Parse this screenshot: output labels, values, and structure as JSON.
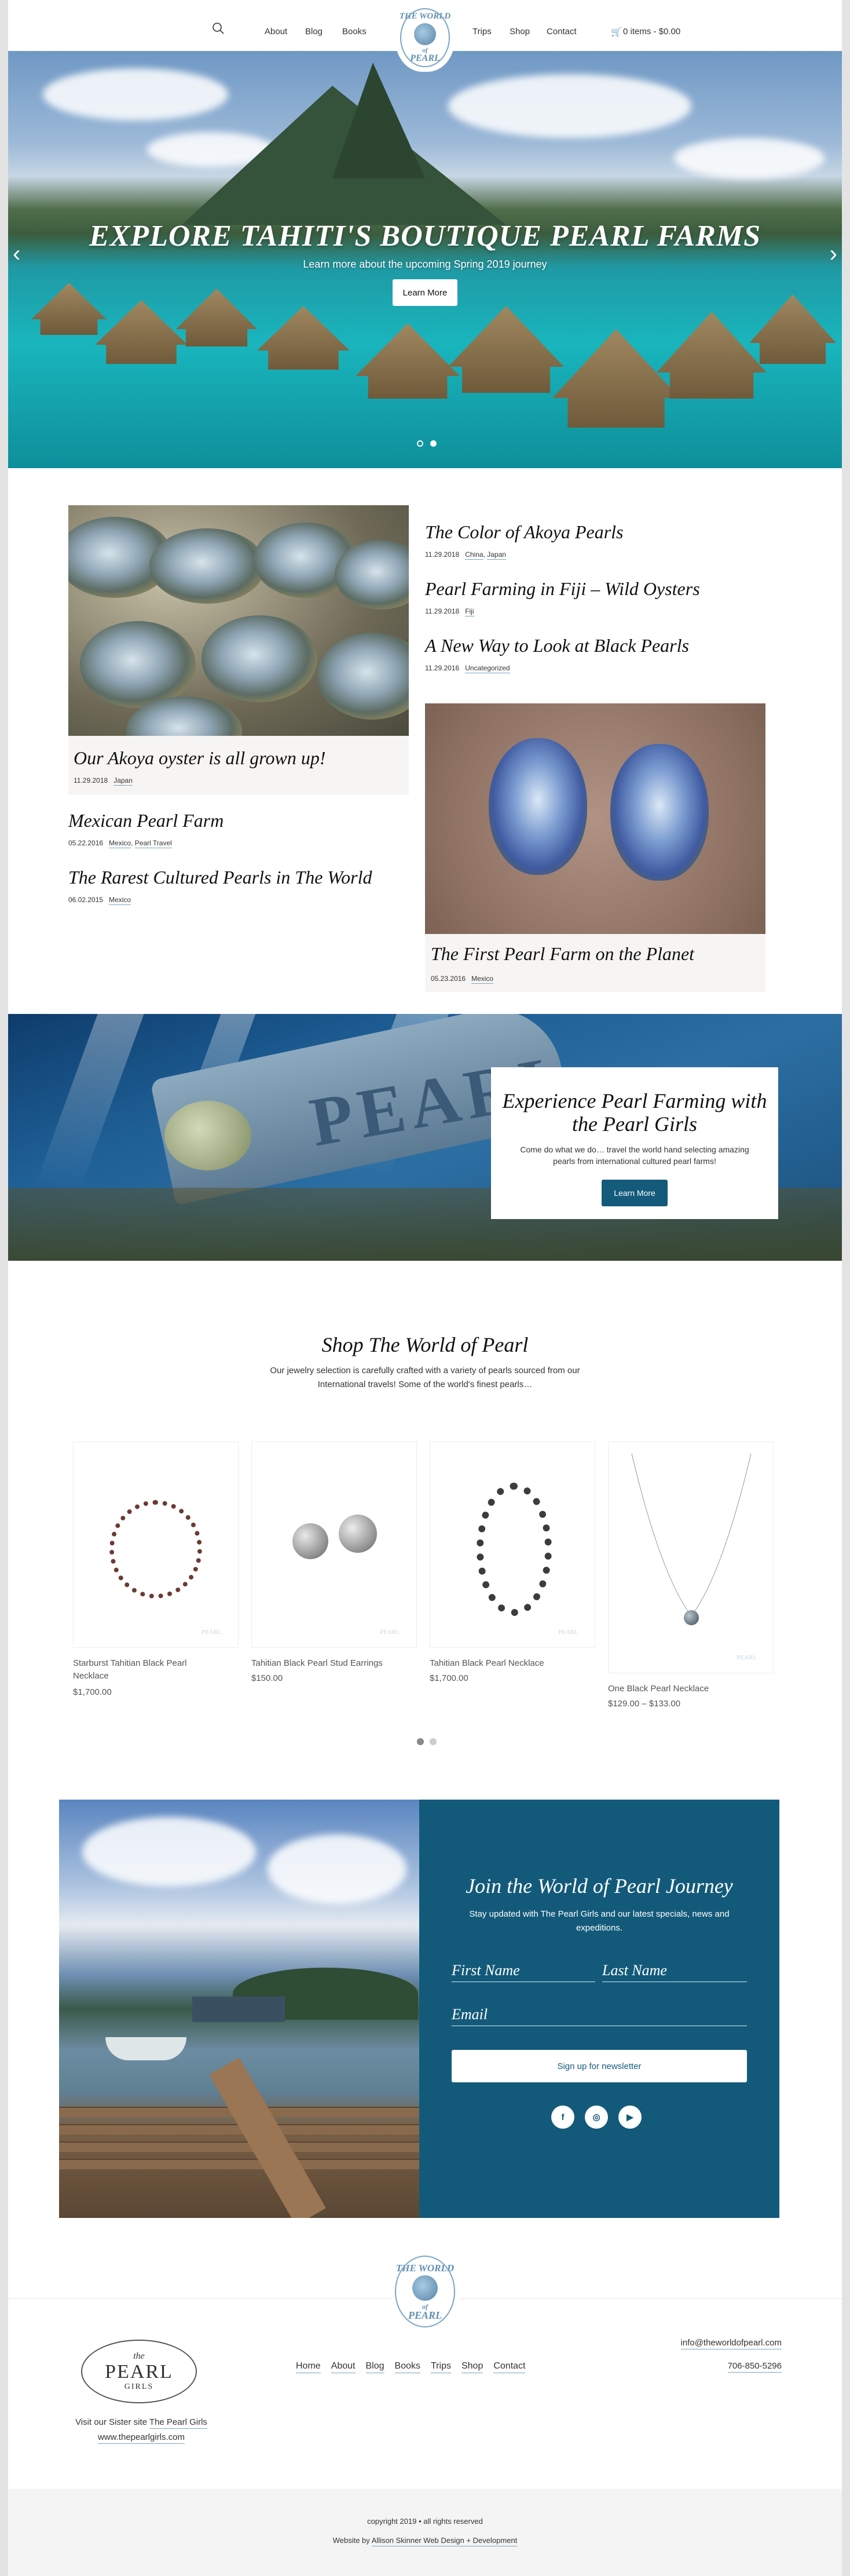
{
  "header": {
    "nav_left": [
      "About",
      "Blog",
      "Books"
    ],
    "nav_right": [
      "Trips",
      "Shop",
      "Contact"
    ],
    "cart_label": "0 items - $0.00",
    "logo_top": "THE WORLD",
    "logo_of": "of",
    "logo_bottom": "PEARL"
  },
  "hero": {
    "title": "EXPLORE TAHITI'S BOUTIQUE PEARL FARMS",
    "subtitle": "Learn more about the upcoming Spring 2019 journey",
    "button": "Learn More"
  },
  "posts": {
    "akoya": {
      "title": "Our Akoya oyster is all grown up!",
      "date": "11.29.2018",
      "tags": "Japan"
    },
    "mexican": {
      "title": "Mexican Pearl Farm",
      "date": "05.22.2016",
      "tag1": "Mexico",
      "tag2": "Pearl Travel"
    },
    "rarest": {
      "title": "The Rarest Cultured Pearls in The World",
      "date": "06.02.2015",
      "tags": "Mexico"
    },
    "color": {
      "title": "The Color of Akoya Pearls",
      "date": "11.29.2018",
      "tag1": "China",
      "tag2": "Japan"
    },
    "fiji": {
      "title": "Pearl Farming in Fiji – Wild Oysters",
      "date": "11.29.2018",
      "tags": "Fiji"
    },
    "black": {
      "title": "A New Way to Look at Black Pearls",
      "date": "11.29.2016",
      "tags": "Uncategorized"
    },
    "first": {
      "title": "The First Pearl Farm on the Planet",
      "date": "05.23.2016",
      "tags": "Mexico"
    }
  },
  "experience": {
    "banner_text": "PEARL",
    "title": "Experience Pearl Farming with the Pearl Girls",
    "body": "Come do what we do… travel the world hand selecting amazing pearls from international cultured pearl farms!",
    "button": "Learn More"
  },
  "shop": {
    "title": "Shop The World of Pearl",
    "intro": "Our jewelry selection is carefully crafted with a variety of pearls sourced from our International travels! Some of the world's finest pearls…",
    "watermark": "PEARL",
    "products": [
      {
        "name": "Starburst Tahitian Black Pearl Necklace",
        "price": "$1,700.00"
      },
      {
        "name": "Tahitian Black Pearl Stud Earrings",
        "price": "$150.00"
      },
      {
        "name": "Tahitian Black Pearl Necklace",
        "price": "$1,700.00"
      },
      {
        "name": "One Black Pearl Necklace",
        "price": "$129.00 – $133.00"
      }
    ]
  },
  "join": {
    "title": "Join the World of Pearl Journey",
    "body": "Stay updated with The Pearl Girls and our latest specials, news and expeditions.",
    "first_name": "First Name",
    "last_name": "Last Name",
    "email": "Email",
    "button": "Sign up for newsletter",
    "social": [
      "f",
      "◎",
      "▶"
    ]
  },
  "footer": {
    "logo_the": "the",
    "logo_pearl": "PEARL",
    "logo_girls": "GIRLS",
    "sister_text": "Visit our Sister site",
    "sister_link": "The Pearl Girls",
    "sister_url": "www.thepearlgirls.com",
    "links": [
      "Home",
      "About",
      "Blog",
      "Books",
      "Trips",
      "Shop",
      "Contact"
    ],
    "email": "info@theworldofpearl.com",
    "phone": "706-850-5296",
    "copyright": "copyright 2019 • all rights reserved",
    "credit_prefix": "Website by",
    "credit_link": "Allison Skinner Web Design + Development"
  },
  "colors": {
    "brand_blue": "#135a7a",
    "logo_blue": "#5f8fb2",
    "tag_underline": "#7aa6c4"
  }
}
